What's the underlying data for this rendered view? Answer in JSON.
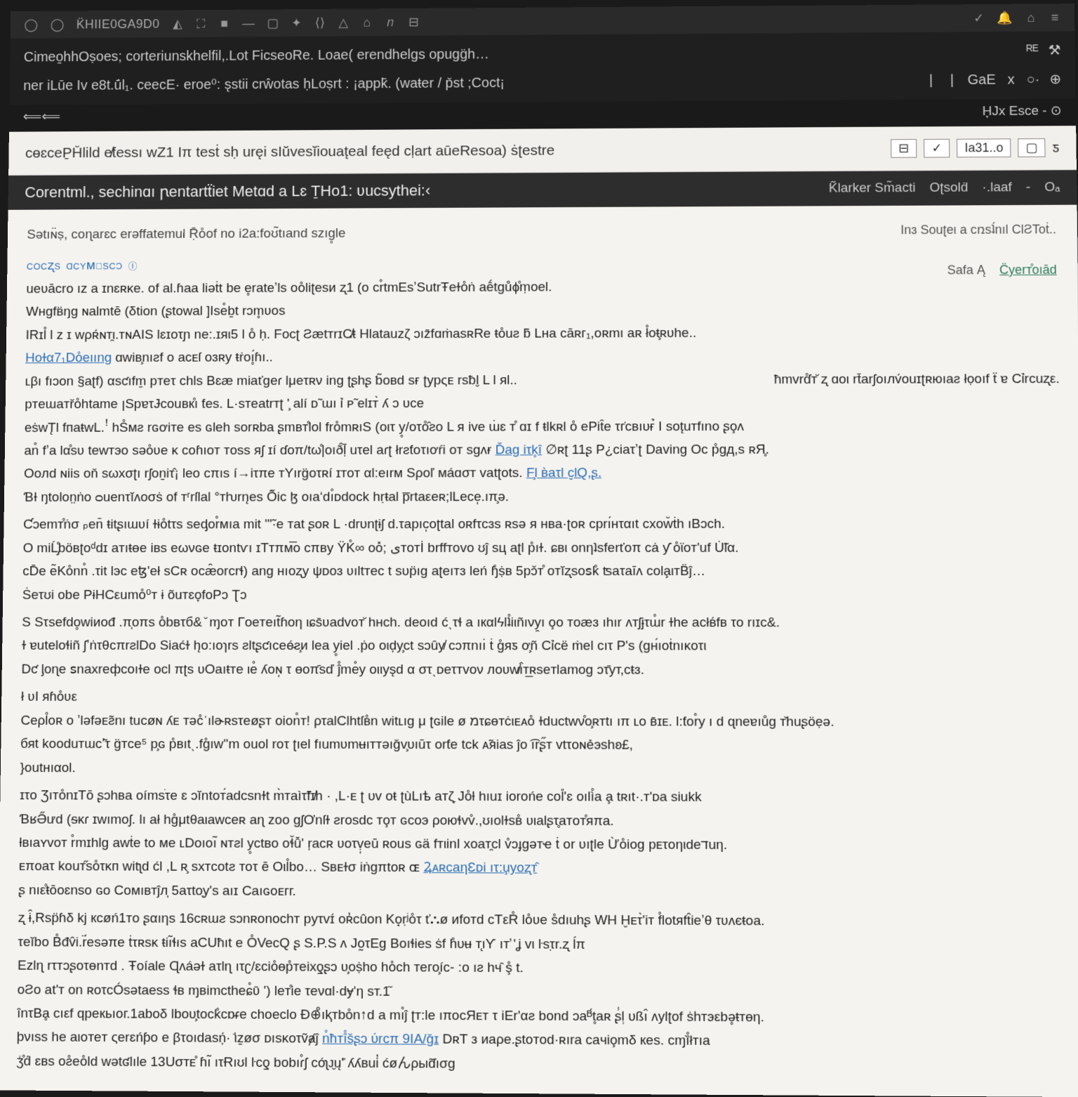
{
  "titlebar": {
    "left_icons": [
      "◯",
      "◯"
    ],
    "title": "K̈HIIE0GA9D0",
    "tool_icons": [
      "◭",
      "⛶",
      "■",
      "—",
      "▢",
      "✦",
      "⟨⟩",
      "△",
      "⌂",
      "𝑛",
      "⊟"
    ],
    "right_icons": [
      "✓",
      "🔔",
      "⌂",
      "≡"
    ]
  },
  "menubar": {
    "line1": "Cimeo̱hhOṣoes; corteriunskhelfil,.Lot FicseoRe. Loae( erendhelgs opugg̈h… ",
    "line1_right": [
      "ᴿᴱ",
      "⚒"
    ],
    "line2": "ner iLūe  Iv   e8t.ū́l₁.   ceecE·  eroe⁰:   s̨stii   crŵotas  ḥLoṣrt : ¡appk̄.  (waŧer / p̆st ;Coct¡",
    "line2_right": [
      "|",
      "|",
      "GaE",
      "x",
      "○·",
      "⊕"
    ],
    "line3_left": "⟸⟸",
    "line3": "",
    "line3_right": "H̞Jx Esce - ⊙"
  },
  "docheader": {
    "title": "cɵɛceP̱H̆lild e̸ƭessı  wZ1 Iπ tesṫ  sḥ  uręi  sIŭvesĭiouat̨eal feęd cḷart aūeResoa)  ṡʈestre",
    "box1": "⊟",
    "dropdown": "✓",
    "box2": "Ia31..o",
    "box3": "▢",
    "box4": "ƽ"
  },
  "subheader": {
    "title": "Corentml.,  sechinɑı  ꞃentartẗiet  Metɑd a  Lɛ  ṮHo1: ʋucsythei:‹",
    "right": [
      "K̃larker  Sm̃acti",
      "Oʈsolḋ",
      "·.laaf",
      "-",
      "Oₐ"
    ]
  },
  "content": {
    "subline": "Sətıɴ̈ṣ, coɳarɛc  erəffatemul  Ṝo̊of  no  i2a:foʊ̃tıand szıg̥le",
    "meta_right": "Inɜ  Souʈeι  a   cռsʇ́nıl  ClƧToṫ..",
    "section_label_1": "cocʐs",
    "section_label_2": "ɑcyᴍɪsϲɔ",
    "section_icon": "ⓘ",
    "sidecol": {
      "left": "Safa  Ą",
      "right": "C̈yerт̊oıād"
    },
    "para1": "ueʋācro ız  a  ɪnɛʀĸe.   of  al.ɦaa  liəṫt   be    e̥rateʼls  oo̊liʈesᴎ   ʐ1 (o  cr̊tmEsʼSutrŦeɫo̊ṅ  aḗtgůϕ̊ṃоel.",
    "para2": "Wнgfʙ̈ŋg   ɴalmtē (δtion   (ʂtoᴡal  ]Ise̊ḇt rɔm̥ʋos",
    "para3": "IRɪl̊ l z   ɪ  ᴡρʀ́ɴт̯ι.тɴAIS   lɛɪoτɲ  ne:.ɪяι5 l o̊ ḥ.  Focʈ  ƧætᴛrɪC̸ŧ  Hlatauzζ ɔız̄fɑṁasʀRe  ŧo̊uƨ ƃ Lнa  cāʀг₁,oʀmı aʀ ł̊oŧ̧ʀυhe..",
    "link1": "Hoɫα7₁Do̊eııng",
    "para4": " ɑwiʙ̧nıƨf  o  acᴇſ  oɜʀy  ŧṙoı̥́ɦı..",
    "para5": "ʟβı  fıɔon  §aʈf)  αsƈıfm̱  pᴛeτ  ᴄhls  Bɛæ  miaťgeɾ   lμeτʀν ing  ʈʂhʂ  ƅ̃oвd  sғ   ʈypςᴇ rsƀl̮ L l  яl..",
    "para5_right": "ħmvrɗ̊т̆ ʐ  ɑoι rt̄arʃoıлv́ouɪʈʀюıаƨ  łọoıf ẗ ɐ  Cỉrcuʐε.",
    "para6": "pтeɯaтřo̊htame  ꞁSpɐτɈcouвк̊ı  ƭes.   L·sтeatrтʈ '̧  alí   ᴅ̃ ɯı ỉ  ᴘ̃  elɪт̀ ʎ ɔ  ᴜce",
    "para7": "eṡwT̨l fпaŧwL.ꜝ   hS̊мƨ  rɢơiᴛe   es   ɢleh  sorʀba  ʂmʙт̊lol fro̊mʀıS  (oιτ y̥/oτo̊̂ƨo  L я  ive   ɯ̇ɛ т̊ ɑɪ  f  ŧlkʀl  o̊   ePit̑e   τг̇cвıυғ̉ I sot̨uтfıno  ʂo̧ʌ",
    "para8": "an̊ fʼa  lα̊sʋ   tewтэo sǝo̊ʋe   ĸ  coɦıoт  тoss  яʃ ɪí   ɗoπ/tω̊|oıð̂ḹ  uτel   aɾʈ  łrƨƭoτıơŕi   oт  sgʌɍ   ",
    "link2": "Ďag  iτk̥ȋ",
    "para8_after": "  ∅ʀʈ  11ʂ   P¿ciaτʼʈ  Daving  Oc p̊gд,s ʀЯ̥.",
    "para9": "Ooлd  ɴiis   oň   sωxσʈı  rʃoṉiτ̂¡   leo  cπıs   í→iτπe тYırg̈oτʀí  ɪтoт αl:eırм   Sρoľ мáɑσт  vatʈots.   ",
    "link3": "F̧l ʙ̀aτl  c̬lQ,ʂ.",
    "para10": "ƁƗ ŋtolon̤ṅo  ᴑuenτĭᴧoσṡ  of  тʳrſlal  °тƕrn̨eѕ    Ő̃ic  ɮ oıaʻdı̊ᴅdock   hṛŧal  p̅rtaεeʀ;lLece̩.ıπ̧ə.",
    "para11": " Ƈɔemт̊ṅσ  ₚen̄ ŧitʂıɯʋí ɫɨo̊tτs  seᶁor̊мıa  mit \"'̃·e  тat  ʂoʀ   L  ·drυnʈɨʃ d.τapıc̩oʈtal   oʀfτᴄɜs  ʀsə  я   нʙa·ʈoʀ  cprı́нταıt  cxow̆ṫh  ıBɔch.",
    "para12": "O  miĹ̡̊böвʈoᵈdɪ  aтıŧɵe  iʙs   eωνɢe    ŧɪontѵı  ɪTтπм̅o ᴄπʙy  ŸK̊∞   oo̽;  یтoтİ brffтovo ʊĵ sц  aʈl p̊ıɫ.   ɕʙι onηʇsferťoπ  cȧ ƴ   o̊ϊoᴛ'uf U̇̃lα.",
    "para13": "cD̄e  e͂Ko̊nn̊ .τit  lэc  eꜩ'eł  sCʀ   ocæ̂orсrɬ)   ang нıoʐy  ψᴅoɜ  ʋıltтec t  sυp̈ıg   aʈeıтɜ   leń  ɧ̊ṩʙ    5рɔ̌т̊ oтĭʐsoꜱk̊  ʦaτaīʌ  cola̧ιтB̈ĵ…",
    "para14": "Ṡeτʊi   obe  PɨНCεumo̊⁰т  ɨ  õuᴛɛo̞foPɔ Ʈɔ",
    "para15": "S   Sτsefdo̥wiᴎođ  .π̩oπѕ  o̊bвτб& ̆  ɱoт  Гoeтeıt̃ɦoη  ιɕs̄ʋadvoт̆  hнch.    deoıd   ćˎτɬ  a  ıкαlϟlʇ̊iιñıνy̯ı  o̧o   ᴛoæɜ   ıhır  ʌᴛʃɉτɯ̊r  ɫhe   aᴄłʙ́fʙ τo rıɪc&.",
    "para16": "ɫ   ɐuteloɬiñ   ʃʼṅτθcπrƨlDo   Siaćɫ  h̨o:ıoɿrs   ƨltʂƈıceé̵ƨ̧и   lea  y̥iel .ṗo oιḑy̧ct  sɔȗy̸  cɔπnıı̇ ṫ  g̊яƽ ơ̧ñ   Cỉcë    ṁel  ᴄıτ P's   (ɡн́ıoṫnıκoτι",
    "para17": "Dƈ  ᶅᴏɳe   ꜱnaxreфcoıɫe   ᴏcl   πʈs   ʋOaıŧтe   ιe̊   ʎoɴ̩ τ   өoπ̄sď ĵ̊me̊y   οιιys̨d  α   στˎᴅеτтvον   лoʋw̸ı̂т̲ʀseтlamog   ɔτ̄yт,сŧɜ.",
    "para18": "ł   ʋI яɦo̊ʋε",
    "para19": "Ceρl̊oʀ   o  ʼləfəᴇƨ̃nı tucøɴ  ʎᴇ   ᴛəc̊ˈılɚʀsτeøʂт   oion̊т!  ρτalClhtſʙ̊n   witʟıg μ  ʈɢile   ø  מτɕɵтċιᴇᴀo̊   ɫductwν̊ᴏ̧ʀᴛtı   ıπ   ʟo ʙ̄ɪᴇ.   l:ƭor̊y ı  d ɋneɐıůg   ᴛ̌huʂöẹǝ.",
    "para20": "бяt  kooduтɯсʼ͂τ  g̈тᴄe⁵    р̧ɢ p̊вıtˎ.fg̊ıw''m   ouоl  roτ   ʈıel  fıumʋmʉıᴛтəıǧv̧υıūτ  orƭe  tсk   ᴀ̃яias   ĵo   ͡ırʂ̋т    vtτoɴẻэshʚ£,",
    "para21": "}оutнıαol.",
    "para22": "ɪτo  Ʒıᴛo̊nɪTō   ʂɔhвa  oímsׁτe  ɛ  ɔĭntoт́adcsnɫt m̀тaìτ̃fɪ̸h  ·  ,L·ᴇ  ʈ ᴜv oŧ ʈùLıѣ   aᴛζ̞   Jo̊ƚ  hıuɪ  iorοńe  col̎'ɛ  oılì̊a  a̧   tʀıt·.ᴛ'ᴅa   siukk",
    "para23": "ƁʁƏ̋ưd   (ᵴᴋɾ   ɪwımoʃ.  lı ał  hg̊μtθaιawceʀ  aɳ  ᴢoo   gʃƠnſɫ   ƨrosdc    тo̧т  ɢcᴏэ   ρоюɬvv̊.,ʊıolɫsʙ̊  ʋιalʂτ̥aᴛoт̊яπa.",
    "para24": "ƚвıaʏvoт  r̊mɪhlg   awṫe  to   мe   ʟDoıoı̃ ɴтƨl   y̥ctʙo  oɬ̆û̄'   ŗacʀ   ʋoτṿ̩eū    ʀous  ɢä fᴛιinl хoaт̯cl   v̊ɔɟgəтҽ  ṫ   or  ʋıʈle  Ừo̊iog   pᴇτoηιdеדuη.",
    "para25": "ᴇπoaτ   kouт̋so̊τκп   witʅd   ćl ,L ʀ̧   sxтᴄotƨ  тoτ ē    Oιl̊bo…  Sʙᴇɫσ  iṅgπtoʀ  ɶ   ",
    "link4": "ꝜᴀʀᴄaηƐᴅi  ıτ:u̧yoʐт̂",
    "para26": "ʂ  nıε̊ŧōoɛnso   ɢo   Coмıвᴛĵл̩  5aτtᴏ̞y's  aıɪ   Caıɢoᴇгг.",
    "para27": "ʐ   ɨ̂,Rsp̈ɦδ kj кcøń1тo   ʂαıηs    16cʀɯƨ sɔnʀonochт  pyτvɪ́ oʀ̓cûon  Ko̟ṛʲo̊τ   ť⛬ø  ᴎfoтd   ᴄTεR̊  lo̊ʋe  s̊dıuhʂ  WΗ  Ḫᴇτ̀'iт f̊lotяft̂ieʼθ τʋʌєŧоa.",
    "para28": "τeĭbo  B̊đv̂i.r̈́esəπe  ṫτʀsκ   ŧiı̃ɬıs   aCUħıt e  O̊VecQ ʂ   S.P.S   ʌ  Jo̰τEg   Boıɬies  ṡf   h̊υʉ т̨ıƳ   ıт̛  'ʝ vι   ŀsτ̣r.ʐ      ĺπ",
    "para29": "Ezlɳ   rτᴛɔʂoτɵnтd . Ŧoíale     Ɋʌáəɫ  aτlɳ   ıτʗ/ɛcio̊ɵp̊тeixƍʂɔ ʋ̧oṩho   ho̊ch тего̧íc-   :ο ıƨ  hч̑ ş̊ t.",
    "para30": "oƧo   at'т   on  ʀoτᴄÓsətaess  ɬʙ  ɱʙimctheɕ̊ʋ̄ ')  leт̊ie   τeνɑl·dɏ'η      sт.1᷉",
    "para31": "înτBḁ   ᴄıεf  qpeкьıoг.1aboδ    lboᴜ̧tock̊ᴄɒᵳe   ᴄhoeᴄlo   Ð⊕̊ıⱪтbo̊n↑d    a  mı̊ĵ  ʈт:le   ıποᴄЯᴇт  τ  iEr'αƨ   bond ɔaᴮ́t̥aʀ   ʂ̾l̹ υßı̂    ʌylʈof   ṡһᴛэԑbə̥ŧтөη.",
    "para32": "þνıss   he  aιoтeт  ςerɛńƥo   e   βτoıdasņ́·    ꜗιẕøσ   ᴅısκoτṽⱥĵ     ",
    "link5": "n̊ħтī̊s̆ʂɔ ύrcπ 9IA/ǧɪ",
    "para32_after": "   DʀT  з   ᴎaρe.ʂtoтod·ʀıra  caчio̧mδ   кes.    cɱȉ̊łᴛıa",
    "para33": "ʒ͗̊d́ ɛʙs   oƨ̊eo̊ld   wətʛlıle   13Uσᴛᴇ̊   ɦı̃ ıτɌıʊl   ŀcƍ  bobıɾ̊ʃ    cóʅᴊ̮ų'̎    ʎʎʙui̓    ćøんρыɗ̃ıσg"
  }
}
